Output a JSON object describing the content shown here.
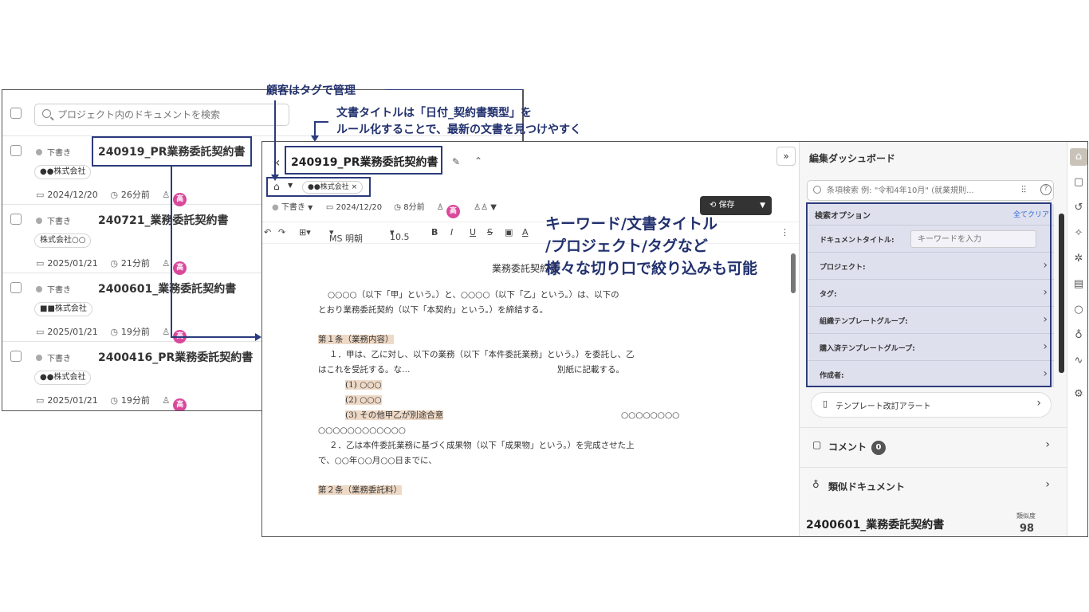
{
  "list": {
    "search_placeholder": "プロジェクト内のドキュメントを検索",
    "items": [
      {
        "status": "下書き",
        "title": "240919_PR業務委託契約書",
        "tag": "●●株式会社",
        "date": "2024/12/20",
        "ago": "26分前",
        "avatar": "高"
      },
      {
        "status": "下書き",
        "title": "240721_業務委託契約書",
        "tag": "株式会社○○",
        "date": "2025/01/21",
        "ago": "21分前",
        "avatar": "高"
      },
      {
        "status": "下書き",
        "title": "2400601_業務委託契約書",
        "tag": "■■株式会社",
        "date": "2025/01/21",
        "ago": "19分前",
        "avatar": "高"
      },
      {
        "status": "下書き",
        "title": "2400416_PR業務委託契約書",
        "tag": "●●株式会社",
        "date": "2025/01/21",
        "ago": "19分前",
        "avatar": "高"
      }
    ]
  },
  "editor": {
    "title": "240919_PR業務委託契約書",
    "collapse": "»",
    "tag_chip": "●●株式会社 ×",
    "status": "下書き",
    "date": "2024/12/20",
    "ago": "8分前",
    "avatar": "高",
    "save_label": "保存",
    "toolbar": {
      "font": "MS 明朝",
      "size": "10.5"
    },
    "page": {
      "heading": "業務委託契約書",
      "lines": [
        "○○○○（以下「甲」という。）と、○○○○（以下「乙」という。）は、以下の",
        "とおり業務委託契約（以下「本契約」という。）を締結する。",
        "第１条（業務内容）",
        "１．甲は、乙に対し、以下の業務（以下「本件委託業務」という。）を委託し、乙",
        "はこれを受託する。な…",
        "(1) ○○○",
        "(2) ○○○",
        "(3) その他甲乙が別途合意",
        "○○○○○○○○○○○○",
        "２．乙は本件委託業務に基づく成果物（以下「成果物」という。）を完成させた上",
        "で、○○年○○月○○日までに、",
        "第２条（業務委託料）"
      ],
      "right_fragment": "○○○○○○○○",
      "mid_fragment": "別紙に記載する。"
    }
  },
  "dashboard": {
    "title": "編集ダッシュボード",
    "search_placeholder": "条項検索 例: \"令和4年10月\" (就業規則...",
    "options_head": "検索オプション",
    "clear_all": "全てクリア",
    "doc_title_label": "ドキュメントタイトル:",
    "keyword_placeholder": "キーワードを入力",
    "rows": [
      "プロジェクト:",
      "タグ:",
      "組織テンプレートグループ:",
      "購入済テンプレートグループ:",
      "作成者:"
    ],
    "alert_label": "テンプレート改訂アラート",
    "comment_label": "コメント",
    "comment_count": "0",
    "similar_label": "類似ドキュメント",
    "similar_doc": "2400601_業務委託契約書",
    "similarity_label": "類似度",
    "similarity_score": "98"
  },
  "annotations": {
    "tag_note": "顧客はタグで管理",
    "title_note_1": "文書タイトルは「日付_契約書類型」を",
    "title_note_2": "ルール化することで、最新の文書を見つけやすく",
    "filter_note_1": "キーワード/文書タイトル",
    "filter_note_2": "/プロジェクト/タグなど",
    "filter_note_3": "様々な切り口で絞り込みも可能"
  },
  "colors": {
    "annotation": "#2c3b7c",
    "avatar": "#d9489a",
    "search_options_bg": "#dfe0ee",
    "link": "#2d6bd6"
  }
}
